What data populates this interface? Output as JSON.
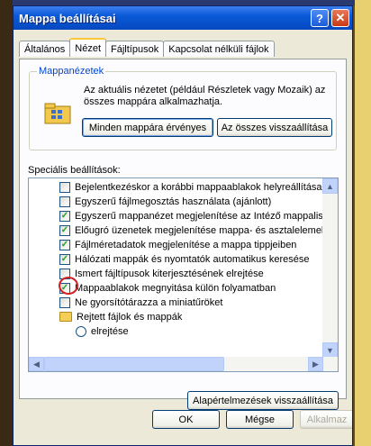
{
  "window": {
    "title": "Mappa beállításai"
  },
  "titlebar_buttons": {
    "help": "?",
    "close": "✕"
  },
  "tabs": [
    {
      "label": "Általános"
    },
    {
      "label": "Nézet"
    },
    {
      "label": "Fájltípusok"
    },
    {
      "label": "Kapcsolat nélküli fájlok"
    }
  ],
  "active_tab": "Nézet",
  "group": {
    "title": "Mappanézetek",
    "description": "Az aktuális nézetet (például Részletek vagy Mozaik) az összes mappára alkalmazhatja.",
    "apply_all_label": "Minden mappára érvényes",
    "reset_all_label": "Az összes visszaállítása"
  },
  "advanced_label": "Speciális beállítások:",
  "settings": [
    {
      "type": "checkbox",
      "checked": false,
      "label": "Bejelentkezéskor a korábbi mappaablakok helyreállítása"
    },
    {
      "type": "checkbox",
      "checked": false,
      "label": "Egyszerű fájlmegosztás használata (ajánlott)"
    },
    {
      "type": "checkbox",
      "checked": true,
      "label": "Egyszerű mappanézet megjelenítése az Intéző mappalistá"
    },
    {
      "type": "checkbox",
      "checked": true,
      "label": "Előugró üzenetek megjelenítése mappa- és asztalelemekh"
    },
    {
      "type": "checkbox",
      "checked": true,
      "label": "Fájlméretadatok megjelenítése a mappa tippjeiben"
    },
    {
      "type": "checkbox",
      "checked": true,
      "label": "Hálózati mappák és nyomtatók automatikus keresése"
    },
    {
      "type": "checkbox",
      "checked": false,
      "label": "Ismert fájltípusok kiterjesztésének elrejtése"
    },
    {
      "type": "checkbox",
      "checked": true,
      "label": "Mappaablakok megnyitása külön folyamatban"
    },
    {
      "type": "checkbox",
      "checked": false,
      "label": "Ne gyorsítótárazza a miniatűröket"
    },
    {
      "type": "folder",
      "label": "Rejtett fájlok és mappák"
    },
    {
      "type": "radio",
      "checked": false,
      "label": "elrejtése"
    }
  ],
  "check_glyph": "✓",
  "scroll_glyphs": {
    "up": "▲",
    "down": "▼",
    "left": "◀",
    "right": "▶"
  },
  "restore_defaults_label": "Alapértelmezések visszaállítása",
  "footer": {
    "ok": "OK",
    "cancel": "Mégse",
    "apply": "Alkalmaz"
  }
}
